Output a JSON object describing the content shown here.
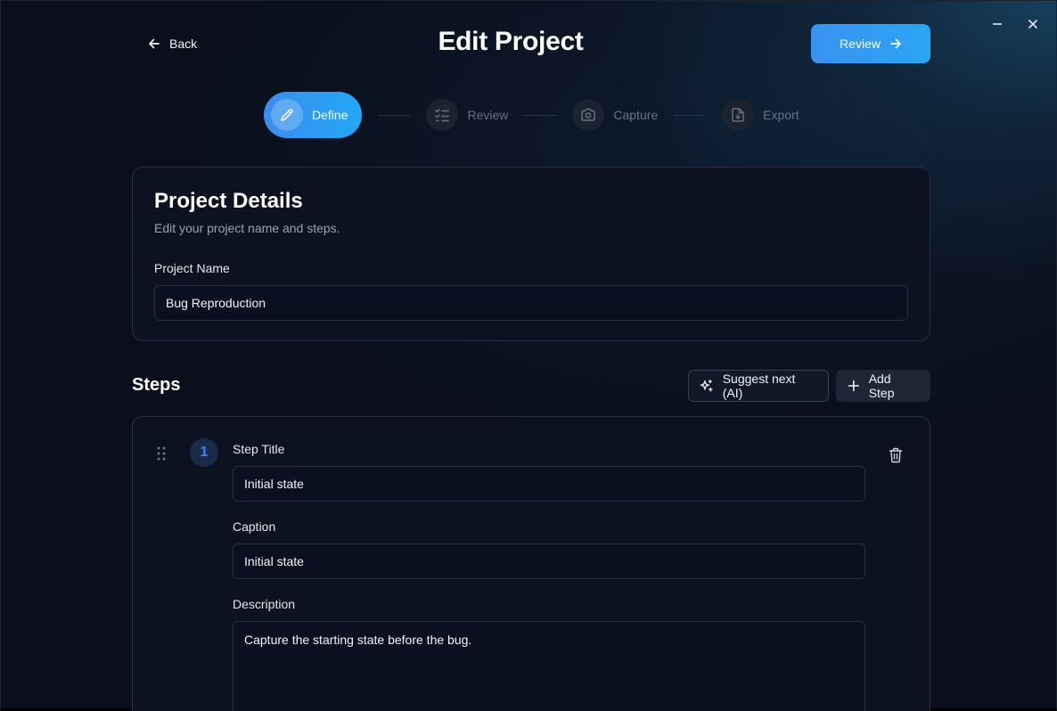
{
  "window": {
    "minimize_icon": "minus-icon",
    "close_icon": "close-icon"
  },
  "header": {
    "back_label": "Back",
    "title": "Edit Project",
    "review_label": "Review"
  },
  "stepper": {
    "steps": [
      {
        "label": "Define",
        "icon": "pencil-icon",
        "active": true
      },
      {
        "label": "Review",
        "icon": "checklist-icon",
        "active": false
      },
      {
        "label": "Capture",
        "icon": "camera-icon",
        "active": false
      },
      {
        "label": "Export",
        "icon": "file-download-icon",
        "active": false
      }
    ]
  },
  "details": {
    "title": "Project Details",
    "subtitle": "Edit your project name and steps.",
    "name_label": "Project Name",
    "name_value": "Bug Reproduction"
  },
  "steps_section": {
    "heading": "Steps",
    "suggest_label": "Suggest next (AI)",
    "add_label": "Add Step"
  },
  "step_items": [
    {
      "number": "1",
      "title_label": "Step Title",
      "title_value": "Initial state",
      "caption_label": "Caption",
      "caption_value": "Initial state",
      "description_label": "Description",
      "description_value": "Capture the starting state before the bug."
    }
  ],
  "colors": {
    "accent_start": "#3a8ded",
    "accent_end": "#22a8f6",
    "background": "#0a0f1b",
    "card_border": "#263042"
  }
}
